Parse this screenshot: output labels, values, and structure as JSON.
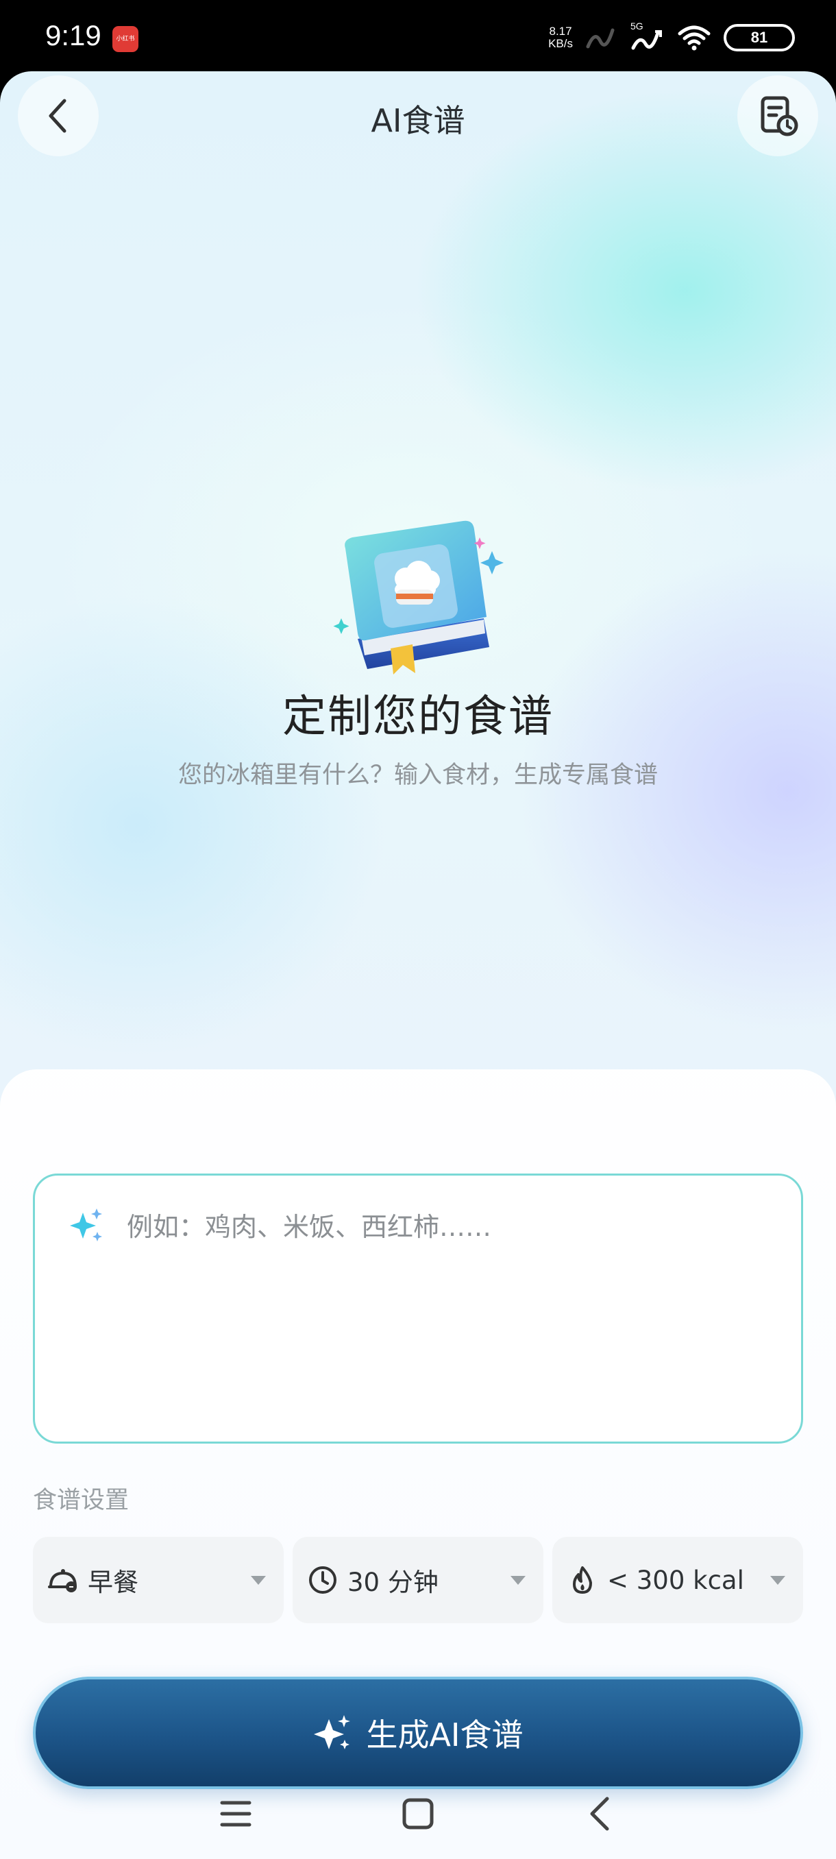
{
  "status_bar": {
    "time": "9:19",
    "app_badge": "小红书",
    "net_speed": "8.17",
    "net_unit": "KB/s",
    "network_type": "5G",
    "battery": "81",
    "battery_level": 0.81
  },
  "header": {
    "title": "AI食谱",
    "back_icon": "chevron-left-icon",
    "history_icon": "recipe-history-icon"
  },
  "hero": {
    "title": "定制您的食谱",
    "subtitle": "您的冰箱里有什么？输入食材，生成专属食谱",
    "image": "recipe-book-chef-hat-illustration"
  },
  "input": {
    "placeholder": "例如：鸡肉、米饭、西红柿……",
    "icon": "sparkle-icon"
  },
  "settings": {
    "label": "食谱设置",
    "meal": "早餐",
    "time": "30 分钟",
    "calories": "< 300 kcal"
  },
  "generate_button": {
    "label": "生成AI食谱"
  },
  "colors": {
    "accent_border": "#7ad9d6",
    "button": "#1c5488",
    "sparkle": "#3fc7e6"
  }
}
